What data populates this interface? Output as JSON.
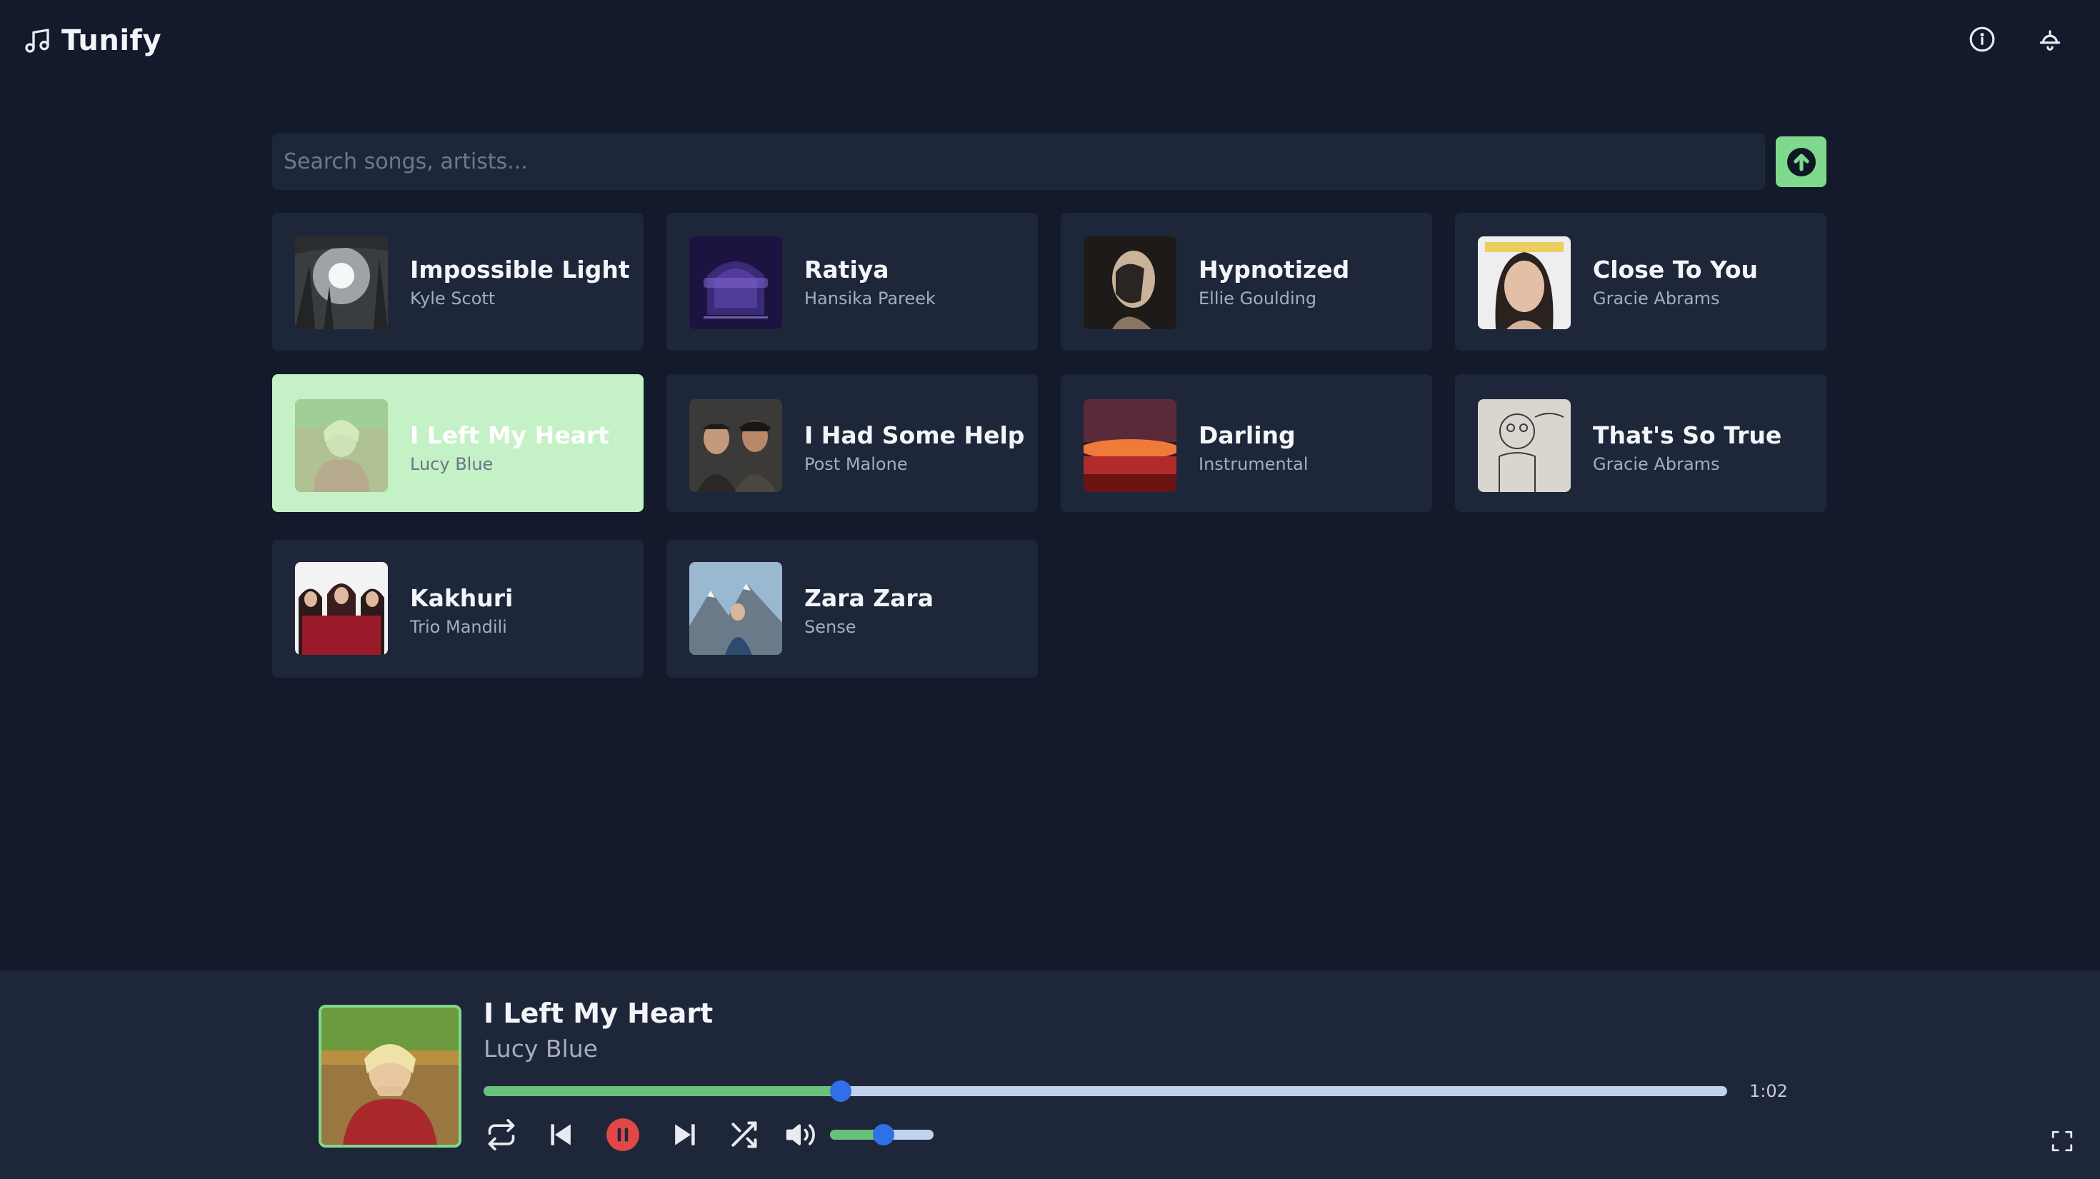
{
  "app": {
    "name": "Tunify",
    "logo_icon": "music-note-icon"
  },
  "header": {
    "info_icon": "info-icon",
    "notification_icon": "bell-icon"
  },
  "search": {
    "placeholder": "Search songs, artists...",
    "value": "",
    "upload_icon": "upload-icon"
  },
  "songs": [
    {
      "title": "Impossible Light",
      "artist": "Kyle Scott",
      "art": "forest",
      "active": false
    },
    {
      "title": "Ratiya",
      "artist": "Hansika Pareek",
      "art": "ratiya",
      "active": false
    },
    {
      "title": "Hypnotized",
      "artist": "Ellie Goulding",
      "art": "hypnotized",
      "active": false
    },
    {
      "title": "Close To You",
      "artist": "Gracie Abrams",
      "art": "portrait",
      "active": false
    },
    {
      "title": "I Left My Heart",
      "artist": "Lucy Blue",
      "art": "lucy",
      "active": true
    },
    {
      "title": "I Had Some Help",
      "artist": "Post Malone",
      "art": "duo",
      "active": false
    },
    {
      "title": "Darling",
      "artist": "Instrumental",
      "art": "sunset",
      "active": false
    },
    {
      "title": "That's So True",
      "artist": "Gracie Abrams",
      "art": "sketch",
      "active": false
    },
    {
      "title": "Kakhuri",
      "artist": "Trio Mandili",
      "art": "trio",
      "active": false
    },
    {
      "title": "Zara Zara",
      "artist": "Sense",
      "art": "mountain",
      "active": false
    }
  ],
  "player": {
    "title": "I Left My Heart",
    "artist": "Lucy Blue",
    "current_time": "1:02",
    "progress_fraction": 0.287,
    "volume_fraction": 0.52,
    "is_playing": true,
    "controls": [
      "repeat-icon",
      "previous-icon",
      "pause-icon",
      "next-icon",
      "shuffle-icon",
      "volume-icon"
    ],
    "fullscreen_icon": "fullscreen-icon"
  },
  "colors": {
    "background": "#121a2b",
    "card": "#1e2739",
    "active_card": "#c4f1c6",
    "accent_green": "#7fd98d",
    "progress_fill": "#68c17a",
    "progress_track": "#c0d2f0",
    "knob_blue": "#2f6fe8",
    "pause_red": "#e04848"
  }
}
